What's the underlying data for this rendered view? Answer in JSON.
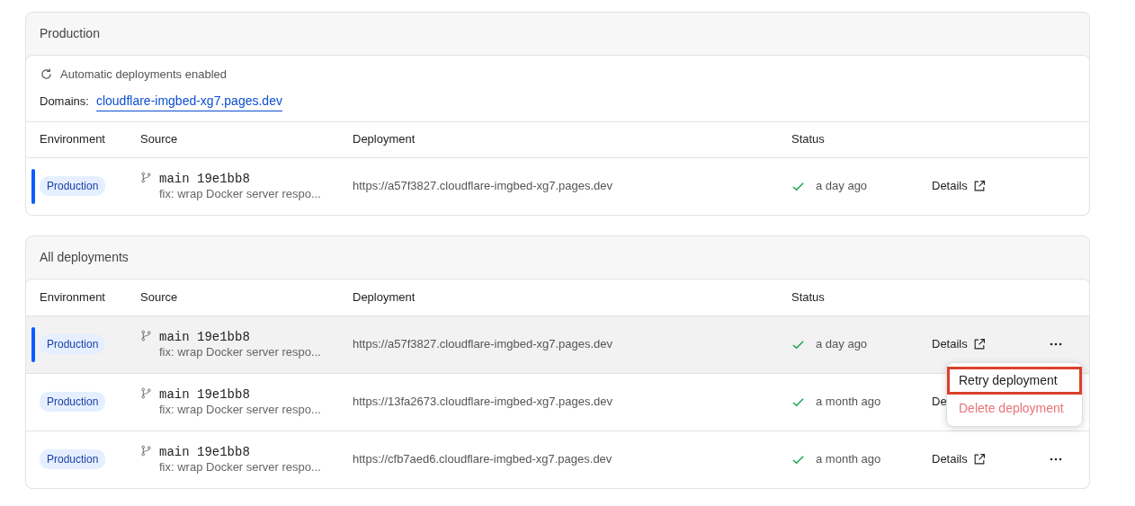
{
  "sections": [
    {
      "title": "Production",
      "auto_deploy": {
        "label": "Automatic deployments enabled"
      },
      "domains": {
        "label": "Domains:",
        "links": [
          "cloudflare-imgbed-xg7.pages.dev"
        ]
      },
      "columns": [
        "Environment",
        "Source",
        "Deployment",
        "Status"
      ],
      "rows": [
        {
          "environment": "Production",
          "current": true,
          "highlighted": false,
          "branch": "main",
          "commit": "19e1bb8",
          "message": "fix: wrap Docker server respo...",
          "url": "https://a57f3827.cloudflare-imgbed-xg7.pages.dev",
          "status": "a day ago",
          "details": "Details",
          "details_icon": true,
          "more_button": false
        }
      ]
    },
    {
      "title": "All deployments",
      "columns": [
        "Environment",
        "Source",
        "Deployment",
        "Status"
      ],
      "rows": [
        {
          "environment": "Production",
          "current": true,
          "highlighted": true,
          "branch": "main",
          "commit": "19e1bb8",
          "message": "fix: wrap Docker server respo...",
          "url": "https://a57f3827.cloudflare-imgbed-xg7.pages.dev",
          "status": "a day ago",
          "details": "Details",
          "details_icon": true,
          "more_button": true,
          "menu": [
            {
              "label": "Retry deployment",
              "kind": "normal",
              "outlined": true
            },
            {
              "label": "Delete deployment",
              "kind": "danger",
              "outlined": false
            }
          ]
        },
        {
          "environment": "Production",
          "current": false,
          "highlighted": false,
          "branch": "main",
          "commit": "19e1bb8",
          "message": "fix: wrap Docker server respo...",
          "url": "https://13fa2673.cloudflare-imgbed-xg7.pages.dev",
          "status": "a month ago",
          "details": "De",
          "details_icon": false,
          "more_button": false
        },
        {
          "environment": "Production",
          "current": false,
          "highlighted": false,
          "branch": "main",
          "commit": "19e1bb8",
          "message": "fix: wrap Docker server respo...",
          "url": "https://cfb7aed6.cloudflare-imgbed-xg7.pages.dev",
          "status": "a month ago",
          "details": "Details",
          "details_icon": true,
          "more_button": true
        }
      ]
    }
  ]
}
